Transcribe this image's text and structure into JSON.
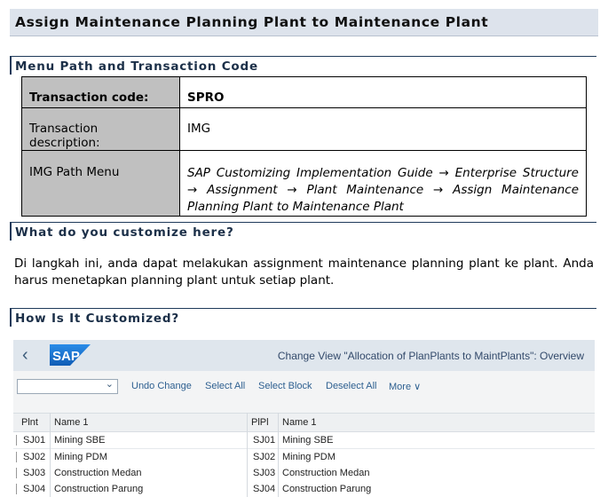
{
  "page_title": "Assign Maintenance Planning Plant to Maintenance Plant",
  "section1": "Menu Path and Transaction Code",
  "tcode_table": {
    "k1": "Transaction code:",
    "v1": "SPRO",
    "k2": "Transaction description:",
    "v2": "IMG",
    "k3": "IMG Path Menu",
    "v3": "SAP Customizing Implementation Guide → Enterprise Structure → Assignment → Plant Maintenance → Assign Maintenance Planning Plant to Maintenance Plant"
  },
  "section2": "What do you customize here?",
  "paragraph": "Di langkah ini, anda dapat melakukan assignment maintenance planning plant ke plant. Anda harus menetapkan planning plant untuk setiap plant.",
  "section3": "How Is It Customized?",
  "sap": {
    "back": "‹",
    "logo_text": "SAP",
    "title": "Change View \"Allocation of PlanPlants to MaintPlants\": Overview",
    "toolbar": {
      "undo": "Undo Change",
      "select_all": "Select All",
      "select_block": "Select Block",
      "deselect_all": "Deselect All",
      "more": "More ∨"
    },
    "columns": [
      "Plnt",
      "Name 1",
      "PlPl",
      "Name 1"
    ],
    "rows": [
      [
        "SJ01",
        "Mining SBE",
        "SJ01",
        "Mining SBE"
      ],
      [
        "SJ02",
        "Mining PDM",
        "SJ02",
        "Mining PDM"
      ],
      [
        "SJ03",
        "Construction Medan",
        "SJ03",
        "Construction Medan"
      ],
      [
        "SJ04",
        "Construction Parung",
        "SJ04",
        "Construction Parung"
      ]
    ],
    "colors": {
      "header_bg": "#dfe6ed",
      "logo_blue": "#1f6fc9",
      "link": "#2d5f90"
    }
  }
}
